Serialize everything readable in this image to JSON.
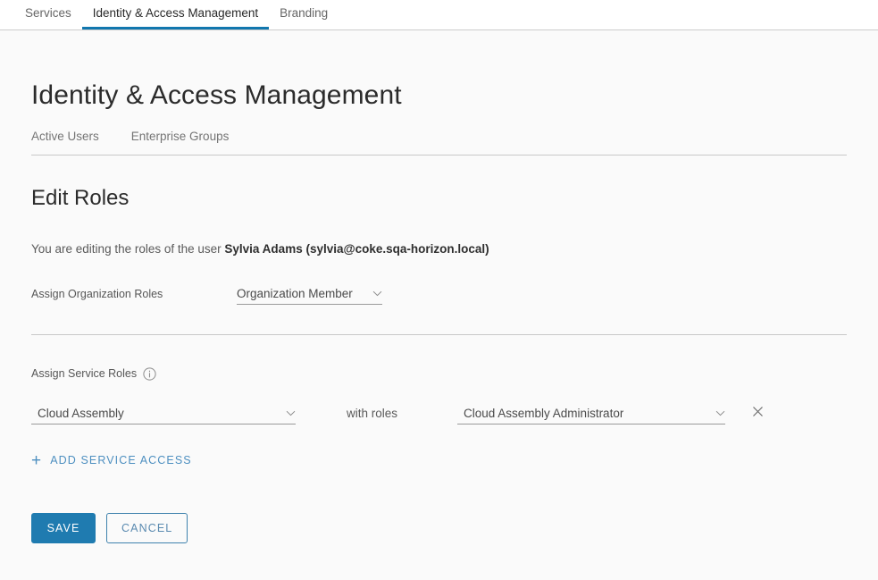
{
  "topbar": {
    "tabs": [
      {
        "label": "Services",
        "active": false
      },
      {
        "label": "Identity & Access Management",
        "active": true
      },
      {
        "label": "Branding",
        "active": false
      }
    ]
  },
  "page": {
    "title": "Identity & Access Management",
    "subtabs": [
      {
        "label": "Active Users"
      },
      {
        "label": "Enterprise Groups"
      }
    ]
  },
  "edit_roles": {
    "heading": "Edit Roles",
    "intro_prefix": "You are editing the roles of the user ",
    "intro_user": "Sylvia Adams (sylvia@coke.sqa-horizon.local)",
    "org_roles_label": "Assign Organization Roles",
    "org_role_value": "Organization Member",
    "service_roles_label": "Assign Service Roles",
    "info_icon": "info-circle-icon",
    "with_roles_label": "with roles",
    "service_rows": [
      {
        "service": "Cloud Assembly",
        "role": "Cloud Assembly Administrator",
        "remove_icon": "close-icon"
      }
    ],
    "add_service_access_label": "Add Service Access",
    "add_icon": "plus-icon",
    "save_label": "Save",
    "cancel_label": "Cancel"
  },
  "colors": {
    "accent": "#1177ae",
    "primary_button": "#1f7bb0",
    "link": "#4d8fc0"
  }
}
